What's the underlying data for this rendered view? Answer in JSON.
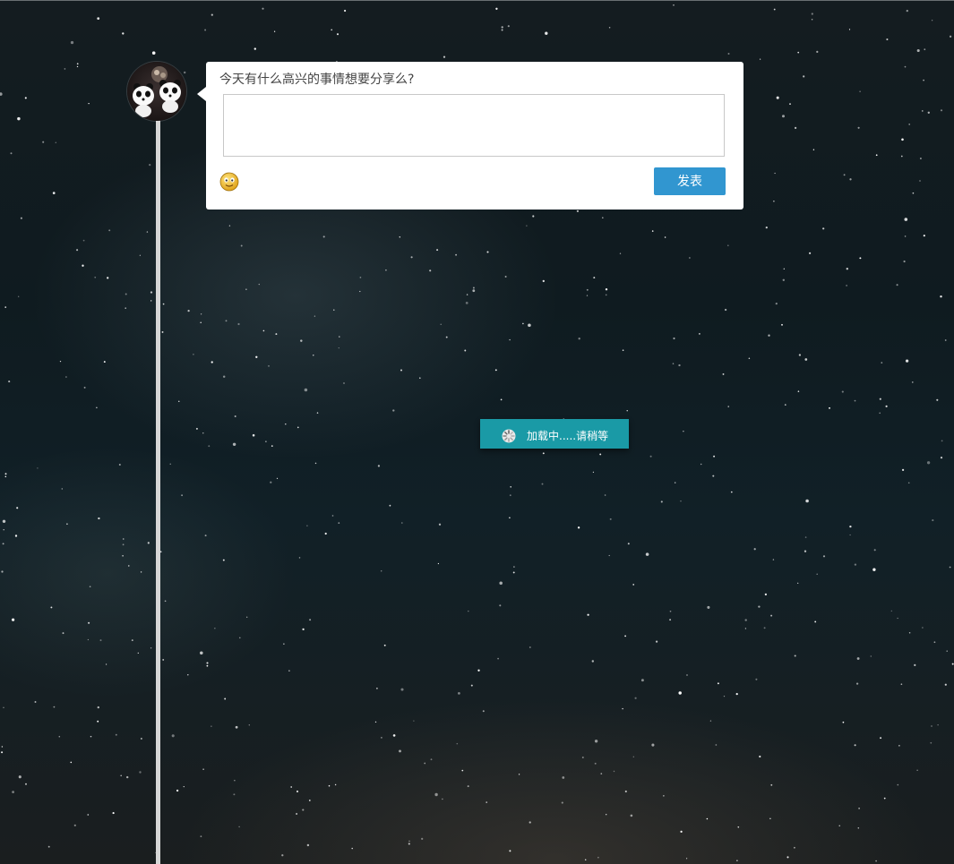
{
  "composer": {
    "prompt": "今天有什么高兴的事情想要分享么?",
    "input_value": "",
    "submit_label": "发表"
  },
  "icons": {
    "avatar": "panda-avatar",
    "emoji": "smiley-face-icon",
    "spinner": "loading-spinner-icon"
  },
  "loading": {
    "text": "加载中.....请稍等"
  },
  "colors": {
    "submit_button": "#3196d0",
    "loading_toast": "#1a9aa6",
    "timeline_line": "#d6d6d6"
  }
}
